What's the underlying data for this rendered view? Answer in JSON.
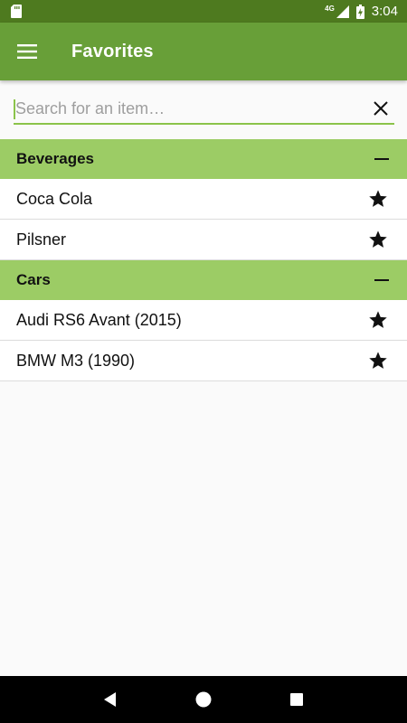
{
  "status_bar": {
    "network": "4G",
    "time": "3:04",
    "icons": [
      "sd-card-icon",
      "signal-icon",
      "battery-charging-icon"
    ]
  },
  "app_bar": {
    "title": "Favorites",
    "menu_icon": "hamburger-menu-icon"
  },
  "search": {
    "placeholder": "Search for an item…",
    "value": "",
    "clear_icon": "close-icon"
  },
  "sections": [
    {
      "title": "Beverages",
      "items": [
        {
          "label": "Coca Cola",
          "favorite": true
        },
        {
          "label": "Pilsner",
          "favorite": true
        }
      ]
    },
    {
      "title": "Cars",
      "items": [
        {
          "label": "Audi RS6 Avant (2015)",
          "favorite": true
        },
        {
          "label": "BMW M3 (1990)",
          "favorite": true
        }
      ]
    }
  ],
  "nav_bar": {
    "icons": [
      "back-icon",
      "home-icon",
      "recents-icon"
    ]
  },
  "colors": {
    "status_bar": "#4e7a1f",
    "app_bar": "#689f38",
    "section_header": "#9ccc65",
    "accent": "#8bc34a"
  }
}
